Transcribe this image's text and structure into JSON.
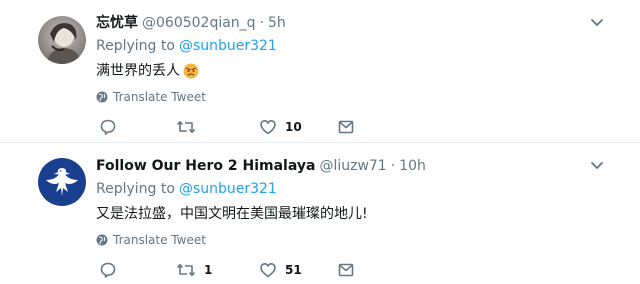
{
  "tweets": [
    {
      "display_name": "忘忧草",
      "handle": "@060502qian_q",
      "separator": "·",
      "time": "5h",
      "replying_label": "Replying to",
      "replying_to": "@sunbuer321",
      "text": "满世界的丢人",
      "emoji": "angry-face-emoji",
      "translate_label": "Translate Tweet",
      "reply_count": "",
      "retweet_count": "",
      "like_count": "10"
    },
    {
      "display_name": "Follow Our Hero 2 Himalaya",
      "handle": "@liuzw71",
      "separator": "·",
      "time": "10h",
      "replying_label": "Replying to",
      "replying_to": "@sunbuer321",
      "text": "又是法拉盛，中国文明在美国最璀璨的地儿!",
      "translate_label": "Translate Tweet",
      "reply_count": "",
      "retweet_count": "1",
      "like_count": "51"
    }
  ],
  "colors": {
    "link": "#1da1f2",
    "secondary_text": "#657786",
    "primary_text": "#14171a",
    "divider": "#e6ecf0",
    "avatar2_bg": "#1b3f8f"
  }
}
